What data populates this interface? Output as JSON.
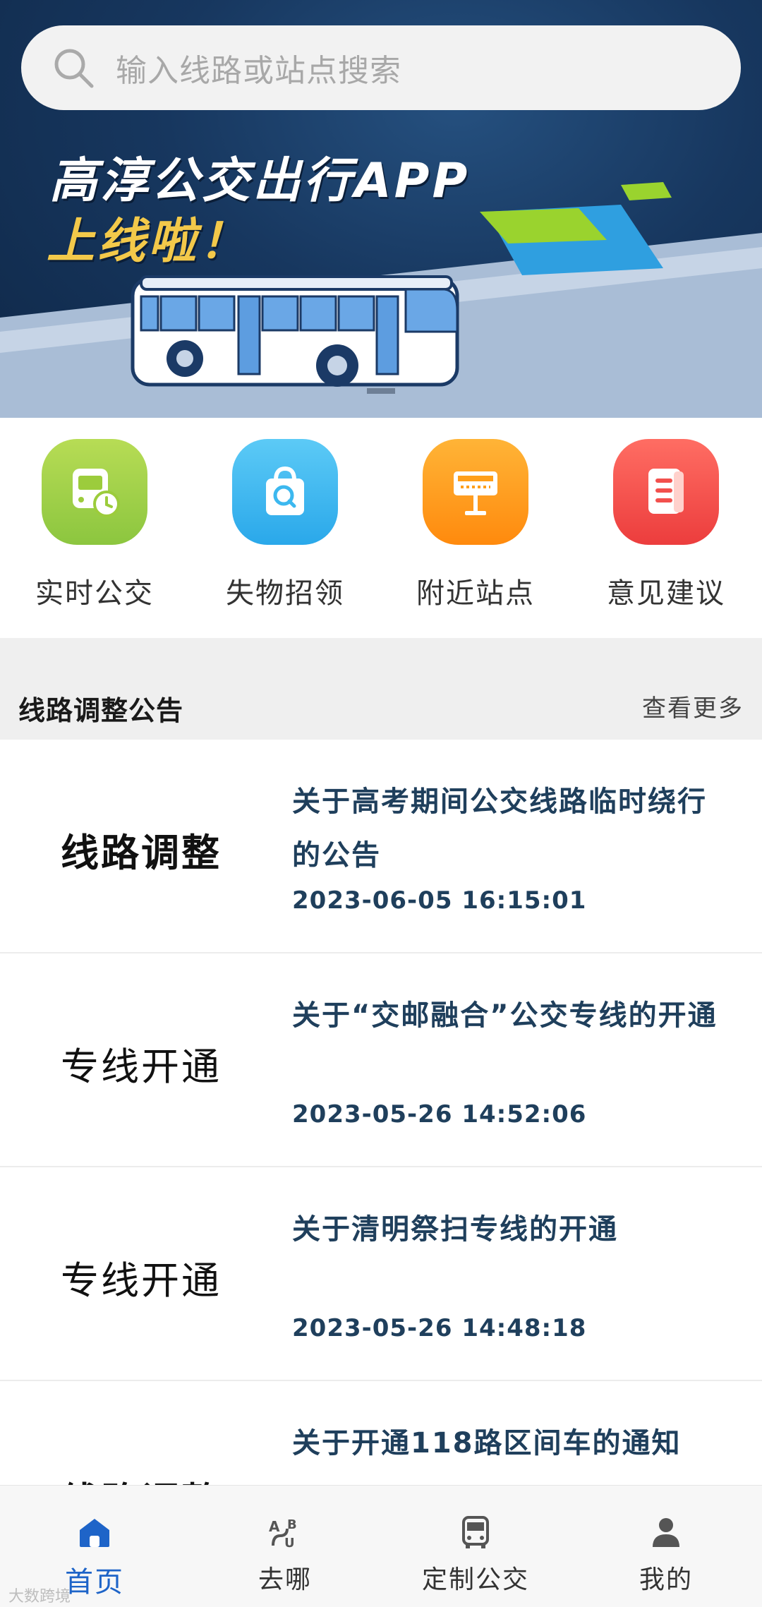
{
  "search": {
    "placeholder": "输入线路或站点搜索"
  },
  "banner": {
    "title_line1": "高淳公交出行APP",
    "title_line2": "上线啦！"
  },
  "quick_actions": [
    {
      "label": "实时公交",
      "icon": "bus-clock-icon",
      "color": "#9ccc3c"
    },
    {
      "label": "失物招领",
      "icon": "lost-found-bag-icon",
      "color": "#3cb8ef"
    },
    {
      "label": "附近站点",
      "icon": "bus-stop-sign-icon",
      "color": "#ff9f1a"
    },
    {
      "label": "意见建议",
      "icon": "feedback-document-icon",
      "color": "#f2504d"
    }
  ],
  "notices_section": {
    "title": "线路调整公告",
    "more_label": "查看更多"
  },
  "notices": [
    {
      "category": "线路调整",
      "title": "关于高考期间公交线路临时绕行的公告",
      "date": "2023-06-05 16:15:01"
    },
    {
      "category": "专线开通",
      "title": "关于“交邮融合”公交专线的开通",
      "date": "2023-05-26 14:52:06"
    },
    {
      "category": "专线开通",
      "title": "关于清明祭扫专线的开通",
      "date": "2023-05-26 14:48:18"
    },
    {
      "category": "线路调整",
      "title": "关于开通118路区间车的通知",
      "date": ""
    }
  ],
  "bottom_nav": [
    {
      "label": "首页",
      "icon": "home-icon",
      "active": true
    },
    {
      "label": "去哪",
      "icon": "route-ab-icon",
      "active": false
    },
    {
      "label": "定制公交",
      "icon": "bus-icon",
      "active": false
    },
    {
      "label": "我的",
      "icon": "user-icon",
      "active": false
    }
  ],
  "colors": {
    "accent": "#1e64c8",
    "notice_text": "#1f3f5c",
    "banner_bg": "#17375f",
    "banner_title_yellow": "#f3c94a"
  },
  "watermark": "大数跨境"
}
